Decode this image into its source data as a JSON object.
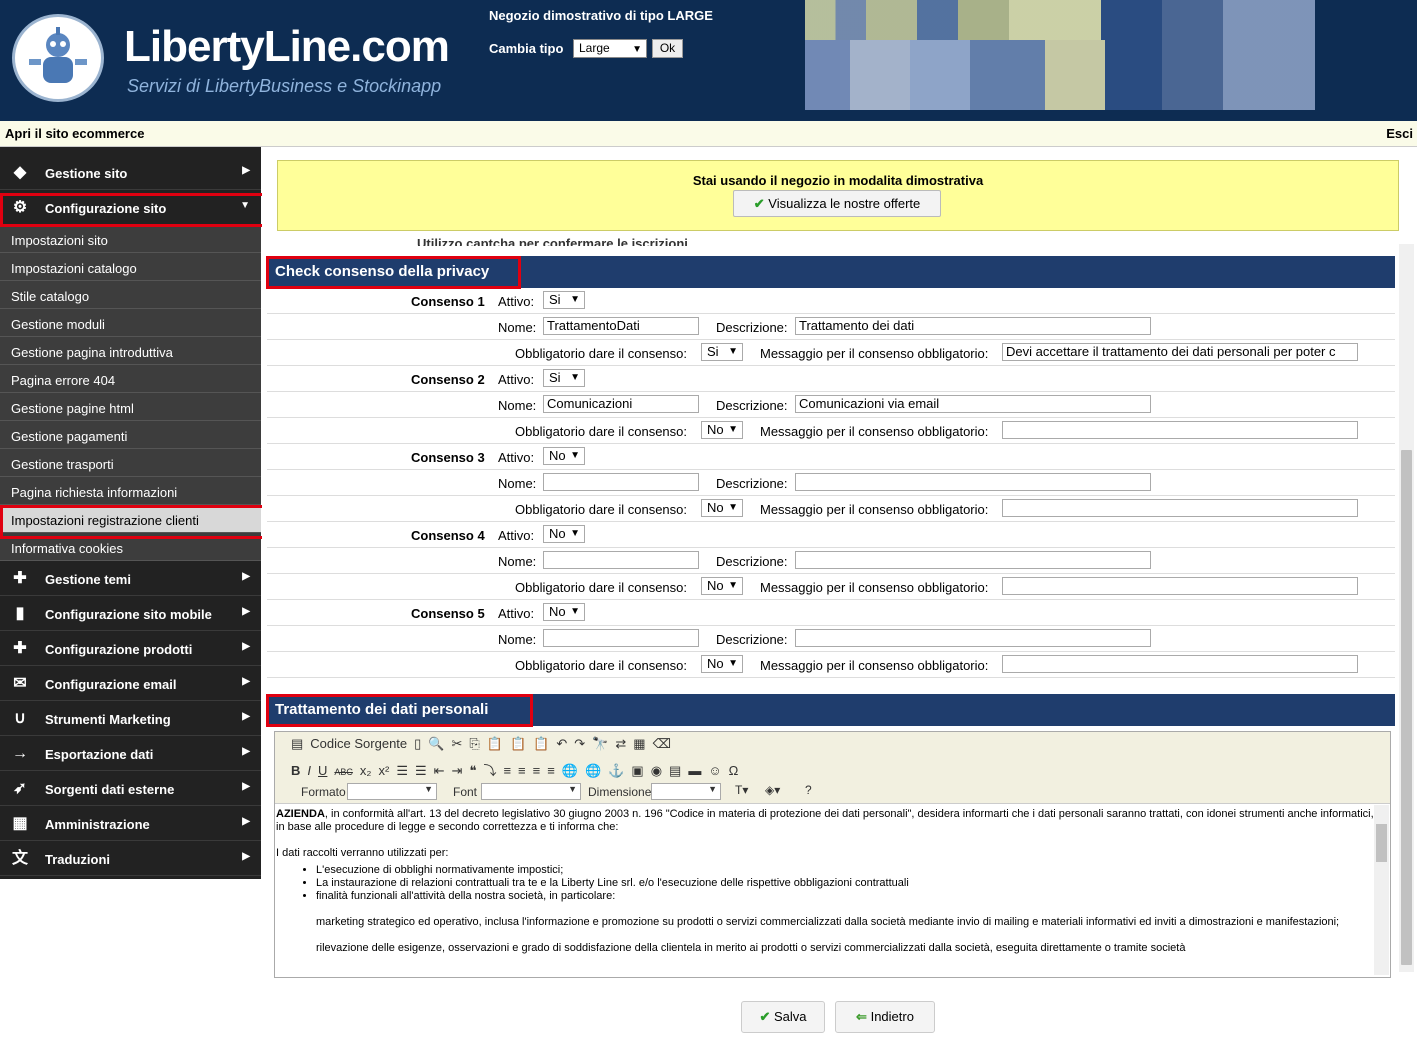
{
  "header": {
    "logo_text": "LibertyLine.com",
    "logo_sub": "Servizi di LibertyBusiness e Stockinapp",
    "demo_title": "Negozio dimostrativo di tipo LARGE",
    "type_label": "Cambia tipo",
    "type_value": "Large",
    "ok_label": "Ok"
  },
  "topbar": {
    "open_site": "Apri il sito ecommerce",
    "exit": "Esci"
  },
  "sidebar": {
    "top": [
      {
        "label": "Gestione sito",
        "icon": "diamond-icon"
      },
      {
        "label": "Configurazione sito",
        "icon": "gear-icon"
      }
    ],
    "subs": [
      "Impostazioni sito",
      "Impostazioni catalogo",
      "Stile catalogo",
      "Gestione moduli",
      "Gestione pagina introduttiva",
      "Pagina errore 404",
      "Gestione pagine html",
      "Gestione pagamenti",
      "Gestione trasporti",
      "Pagina richiesta informazioni",
      "Impostazioni registrazione clienti",
      "Informativa cookies"
    ],
    "bottom": [
      {
        "label": "Gestione temi",
        "icon": "puzzle-icon"
      },
      {
        "label": "Configurazione sito mobile",
        "icon": "mobile-icon"
      },
      {
        "label": "Configurazione prodotti",
        "icon": "puzzle-icon"
      },
      {
        "label": "Configurazione email",
        "icon": "envelope-icon"
      },
      {
        "label": "Strumenti Marketing",
        "icon": "magnet-icon"
      },
      {
        "label": "Esportazione dati",
        "icon": "arrow-right-icon"
      },
      {
        "label": "Sorgenti dati esterne",
        "icon": "rocket-icon"
      },
      {
        "label": "Amministrazione",
        "icon": "building-icon"
      },
      {
        "label": "Traduzioni",
        "icon": "translate-icon"
      }
    ]
  },
  "demo": {
    "message": "Stai usando il negozio in modalita dimostrativa",
    "offers_button": "Visualizza le nostre offerte"
  },
  "cut_row": "Utilizzo captcha per confermare le iscrizioni",
  "privacy": {
    "title": "Check consenso della privacy",
    "labels": {
      "attivo": "Attivo:",
      "nome": "Nome:",
      "descrizione": "Descrizione:",
      "obbligatorio": "Obbligatorio dare il consenso:",
      "messaggio": "Messaggio per il consenso obbligatorio:"
    },
    "consents": [
      {
        "title": "Consenso 1",
        "attivo": "Si",
        "nome": "TrattamentoDati",
        "descrizione": "Trattamento dei dati",
        "obbligatorio": "Si",
        "messaggio": "Devi accettare il trattamento dei dati personali per poter c"
      },
      {
        "title": "Consenso 2",
        "attivo": "Si",
        "nome": "Comunicazioni",
        "descrizione": "Comunicazioni via email",
        "obbligatorio": "No",
        "messaggio": ""
      },
      {
        "title": "Consenso 3",
        "attivo": "No",
        "nome": "",
        "descrizione": "",
        "obbligatorio": "No",
        "messaggio": ""
      },
      {
        "title": "Consenso 4",
        "attivo": "No",
        "nome": "",
        "descrizione": "",
        "obbligatorio": "No",
        "messaggio": ""
      },
      {
        "title": "Consenso 5",
        "attivo": "No",
        "nome": "",
        "descrizione": "",
        "obbligatorio": "No",
        "messaggio": ""
      }
    ]
  },
  "treatment": {
    "title": "Trattamento dei dati personali"
  },
  "editor": {
    "source_label": "Codice Sorgente",
    "format_label": "Formato",
    "font_label": "Font",
    "size_label": "Dimensione",
    "p1_bold": "AZIENDA",
    "p1": ", in conformità all'art. 13 del decreto legislativo 30 giugno 2003 n. 196 \"Codice in materia di protezione dei dati personali\", desidera informarti che i dati personali saranno trattati, con idonei strumenti anche informatici, in base alle procedure di legge e secondo correttezza e ti informa che:",
    "p2": "I dati raccolti verranno utilizzati per:",
    "items": [
      "L'esecuzione di obblighi normativamente impostici;",
      "La instaurazione di relazioni contrattuali tra te e la Liberty Line srl. e/o l'esecuzione delle rispettive obbligazioni contrattuali",
      "finalità funzionali all'attività della nostra società, in particolare:"
    ],
    "p3": "marketing strategico ed operativo, inclusa l'informazione e promozione su prodotti o servizi commercializzati dalla società mediante invio di mailing e materiali informativi ed inviti a dimostrazioni e manifestazioni;",
    "p4": "rilevazione delle esigenze, osservazioni e grado di soddisfazione della clientela in merito ai prodotti o servizi commercializzati dalla società, eseguita direttamente o tramite società"
  },
  "actions": {
    "save": "Salva",
    "back": "Indietro"
  }
}
